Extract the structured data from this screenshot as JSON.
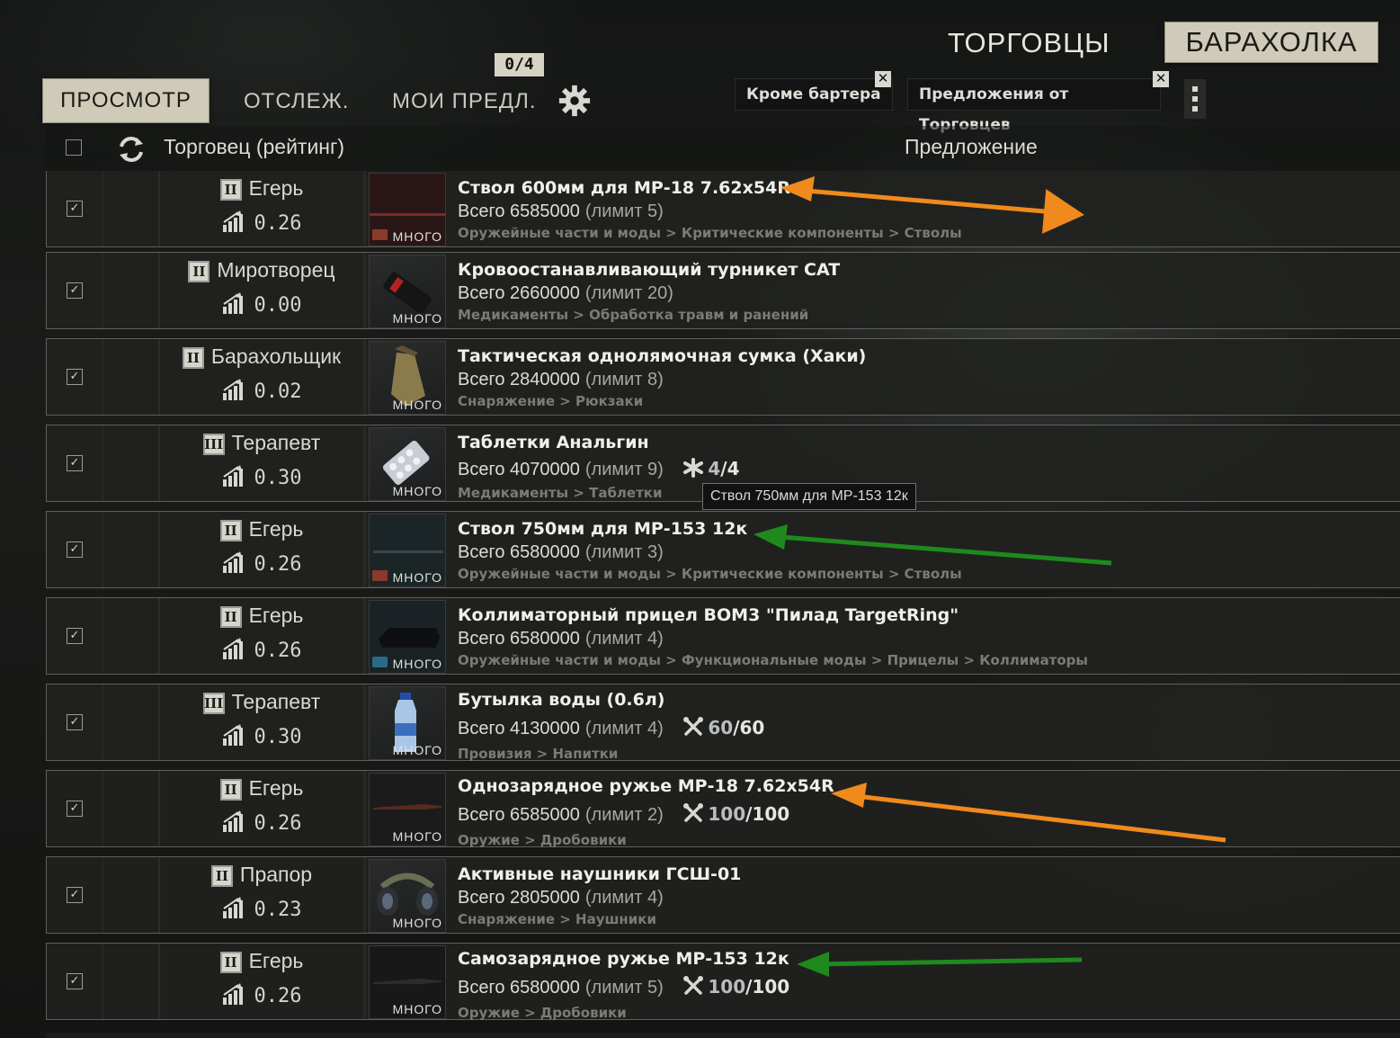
{
  "header": {
    "traders_tab": "ТОРГОВЦЫ",
    "flea_tab": "БАРАХОЛКА",
    "browse_tab": "ПРОСМОТР",
    "watch_tab": "ОТСЛЕЖ.",
    "my_offers_tab": "МОИ ПРЕДЛ.",
    "offer_count": "0/4",
    "filters": [
      {
        "label": "Кроме бартера"
      },
      {
        "label": "Предложения от Торговцев"
      }
    ]
  },
  "columns": {
    "trader": "Торговец (рейтинг)",
    "offer": "Предложение"
  },
  "rows": [
    {
      "loyalty": "II",
      "trader": "Егерь",
      "rating": "0.26",
      "qty": "МНОГО",
      "name": "Ствол 600мм для МР-18 7.62x54R",
      "total": "Всего 6585000",
      "limit": "(лимит 5)",
      "category": "Оружейные части и моды > Критические компоненты > Стволы"
    },
    {
      "loyalty": "II",
      "trader": "Миротворец",
      "rating": "0.00",
      "qty": "МНОГО",
      "name": "Кровоостанавливающий турникет CAT",
      "total": "Всего 2660000",
      "limit": "(лимит 20)",
      "category": "Медикаменты > Обработка травм и ранений"
    },
    {
      "loyalty": "II",
      "trader": "Барахольщик",
      "rating": "0.02",
      "qty": "МНОГО",
      "name": "Тактическая однолямочная сумка (Хаки)",
      "total": "Всего 2840000",
      "limit": "(лимит 8)",
      "category": "Снаряжение > Рюкзаки"
    },
    {
      "loyalty": "III",
      "trader": "Терапевт",
      "rating": "0.30",
      "qty": "МНОГО",
      "name": "Таблетки Анальгин",
      "total": "Всего 4070000",
      "limit": "(лимит 9)",
      "cond_cur": "4",
      "cond_max": "/4",
      "category": "Медикаменты > Таблетки"
    },
    {
      "loyalty": "II",
      "trader": "Егерь",
      "rating": "0.26",
      "qty": "МНОГО",
      "name": "Ствол 750мм для МР-153 12к",
      "total": "Всего 6580000",
      "limit": "(лимит 3)",
      "category": "Оружейные части и моды > Критические компоненты > Стволы"
    },
    {
      "loyalty": "II",
      "trader": "Егерь",
      "rating": "0.26",
      "qty": "МНОГО",
      "name": "Коллиматорный прицел BOM3 \"Пилад TargetRing\"",
      "total": "Всего 6580000",
      "limit": "(лимит 4)",
      "category": "Оружейные части и моды > Функциональные моды > Прицелы > Коллиматоры"
    },
    {
      "loyalty": "III",
      "trader": "Терапевт",
      "rating": "0.30",
      "qty": "МНОГО",
      "name": "Бутылка воды (0.6л)",
      "total": "Всего 4130000",
      "limit": "(лимит 4)",
      "cond_cur": "60",
      "cond_max": "/60",
      "category": "Провизия > Напитки"
    },
    {
      "loyalty": "II",
      "trader": "Егерь",
      "rating": "0.26",
      "qty": "МНОГО",
      "name": "Однозарядное ружье МР-18 7.62x54R",
      "total": "Всего 6585000",
      "limit": "(лимит 2)",
      "cond_cur": "100",
      "cond_max": "/100",
      "category": "Оружие > Дробовики"
    },
    {
      "loyalty": "II",
      "trader": "Прапор",
      "rating": "0.23",
      "qty": "МНОГО",
      "name": "Активные наушники ГСШ-01",
      "total": "Всего 2805000",
      "limit": "(лимит 4)",
      "category": "Снаряжение > Наушники"
    },
    {
      "loyalty": "II",
      "trader": "Егерь",
      "rating": "0.26",
      "qty": "МНОГО",
      "name": "Самозарядное ружье МР-153 12к",
      "total": "Всего 6580000",
      "limit": "(лимит 5)",
      "cond_cur": "100",
      "cond_max": "/100",
      "category": "Оружие > Дробовики"
    }
  ],
  "tooltip": "Ствол 750мм для МР-153 12к",
  "colors": {
    "accent_tab": "#cfcbb8",
    "arrow_orange": "#f08a1c",
    "arrow_green": "#1e8a1e"
  }
}
